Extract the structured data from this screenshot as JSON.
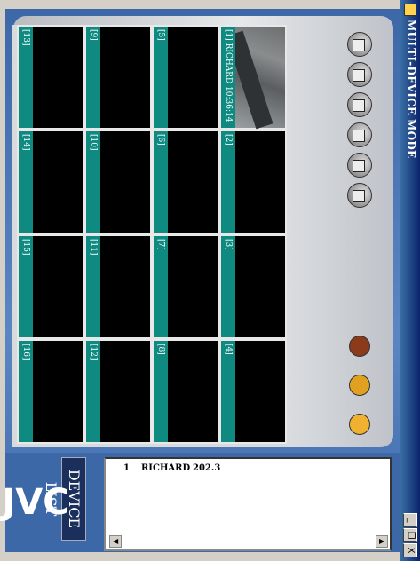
{
  "window": {
    "title": "MULTI-DEVICE MODE",
    "buttons": [
      "_",
      "❐",
      "X"
    ]
  },
  "brand": {
    "logo": "JVC"
  },
  "device_list": {
    "title": "DEVICE LIST",
    "rows": [
      {
        "index": "1",
        "name": "RICHARD",
        "address": "202.3"
      }
    ]
  },
  "cells": [
    {
      "label": "[1]  RICHARD  10:36:14",
      "has_image": true
    },
    {
      "label": "[2]"
    },
    {
      "label": "[3]"
    },
    {
      "label": "[4]"
    },
    {
      "label": "[5]"
    },
    {
      "label": "[6]"
    },
    {
      "label": "[7]"
    },
    {
      "label": "[8]"
    },
    {
      "label": "[9]"
    },
    {
      "label": "[10]"
    },
    {
      "label": "[11]"
    },
    {
      "label": "[12]"
    },
    {
      "label": "[13]"
    },
    {
      "label": "[14]"
    },
    {
      "label": "[15]"
    },
    {
      "label": "[16]"
    }
  ],
  "mode_buttons": [
    "single-view-icon",
    "quad-view-icon",
    "nine-view-icon",
    "sixteen-view-icon",
    "record-mode-icon",
    "playback-mode-icon"
  ],
  "action_buttons": [
    "stop-icon",
    "snapshot-icon",
    "open-folder-icon"
  ],
  "colors": {
    "accent": "#0f8a80",
    "panel_blue": "#3d68a8",
    "device_title_bg": "#1a2f5c"
  }
}
